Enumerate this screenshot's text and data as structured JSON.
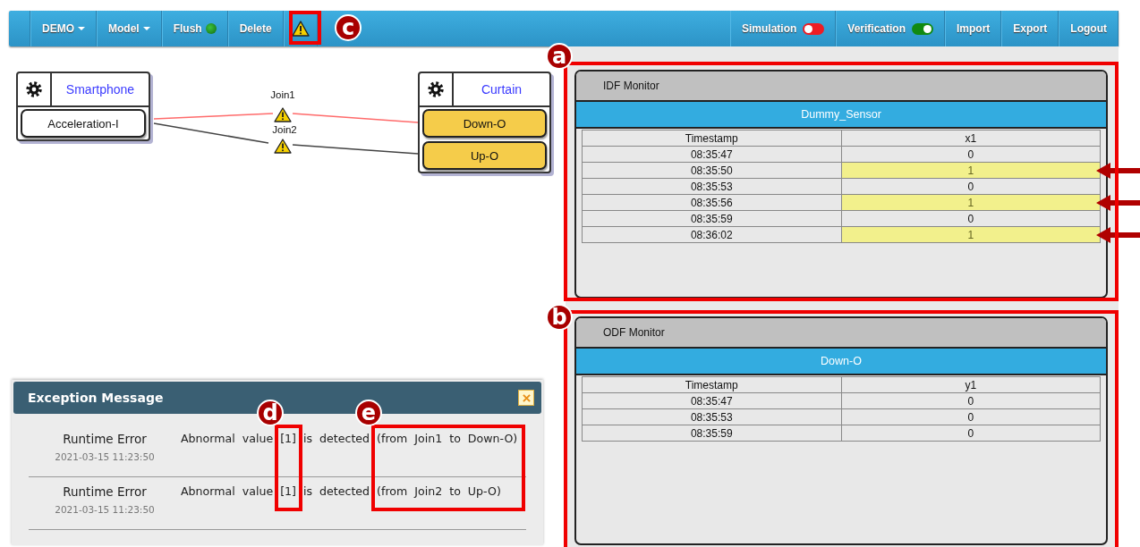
{
  "navbar": {
    "left": [
      {
        "kind": "dropdown",
        "label": "DEMO"
      },
      {
        "kind": "dropdown",
        "label": "Model"
      },
      {
        "kind": "status",
        "label": "Flush"
      },
      {
        "kind": "plain",
        "label": "Delete"
      },
      {
        "kind": "warning"
      }
    ],
    "right": [
      {
        "kind": "toggle",
        "label": "Simulation",
        "on": false
      },
      {
        "kind": "toggle",
        "label": "Verification",
        "on": true
      },
      {
        "kind": "plain",
        "label": "Import"
      },
      {
        "kind": "plain",
        "label": "Export"
      },
      {
        "kind": "plain",
        "label": "Logout"
      }
    ]
  },
  "diagram": {
    "devices": [
      {
        "name": "Smartphone",
        "features": [
          {
            "name": "Acceleration-I",
            "kind": "input"
          }
        ]
      },
      {
        "name": "Curtain",
        "features": [
          {
            "name": "Down-O",
            "kind": "output"
          },
          {
            "name": "Up-O",
            "kind": "output"
          }
        ]
      }
    ],
    "joins": [
      {
        "label": "Join1",
        "color": "#ff6b6b",
        "warning": true
      },
      {
        "label": "Join2",
        "color": "#444444",
        "warning": true
      }
    ]
  },
  "monitors": [
    {
      "title": "IDF Monitor",
      "device": "Dummy_Sensor",
      "columns": [
        "Timestamp",
        "x1"
      ],
      "rows": [
        {
          "cells": [
            "08:35:47",
            "0"
          ],
          "highlighted": false
        },
        {
          "cells": [
            "08:35:50",
            "1"
          ],
          "highlighted": true
        },
        {
          "cells": [
            "08:35:53",
            "0"
          ],
          "highlighted": false
        },
        {
          "cells": [
            "08:35:56",
            "1"
          ],
          "highlighted": true
        },
        {
          "cells": [
            "08:35:59",
            "0"
          ],
          "highlighted": false
        },
        {
          "cells": [
            "08:36:02",
            "1"
          ],
          "highlighted": true
        }
      ]
    },
    {
      "title": "ODF Monitor",
      "device": "Down-O",
      "columns": [
        "Timestamp",
        "y1"
      ],
      "rows": [
        {
          "cells": [
            "08:35:47",
            "0"
          ],
          "highlighted": false
        },
        {
          "cells": [
            "08:35:53",
            "0"
          ],
          "highlighted": false
        },
        {
          "cells": [
            "08:35:59",
            "0"
          ],
          "highlighted": false
        }
      ]
    }
  ],
  "exceptions": {
    "title": "Exception Message",
    "items": [
      {
        "type": "Runtime Error",
        "time": "2021-03-15 11:23:50",
        "message": "Abnormal value [1] is detected (from Join1 to Down-O)"
      },
      {
        "type": "Runtime Error",
        "time": "2021-03-15 11:23:50",
        "message": "Abnormal value [1] is detected (from Join2 to Up-O)"
      }
    ]
  },
  "annotations": [
    {
      "label": "a"
    },
    {
      "label": "b"
    },
    {
      "label": "c"
    },
    {
      "label": "d"
    },
    {
      "label": "e"
    }
  ]
}
